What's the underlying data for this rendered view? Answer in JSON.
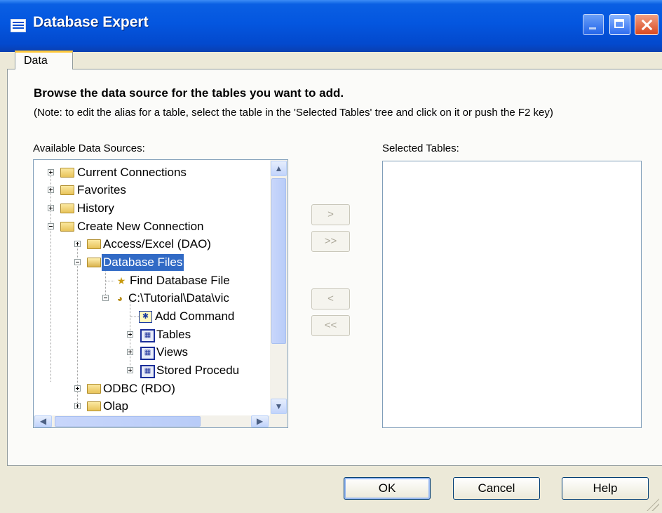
{
  "window": {
    "title": "Database Expert"
  },
  "tabs": [
    {
      "label": "Data"
    }
  ],
  "content": {
    "heading": "Browse the data source for the tables you want to add.",
    "note": "(Note: to edit the alias for a table, select the table in the 'Selected Tables' tree and click on it or push the F2 key)",
    "available_label": "Available Data Sources:",
    "selected_label": "Selected Tables:"
  },
  "tree": {
    "items": [
      {
        "label": "Current Connections",
        "expander": "plus",
        "icon": "folder-icon"
      },
      {
        "label": "Favorites",
        "expander": "plus",
        "icon": "folder-icon"
      },
      {
        "label": "History",
        "expander": "plus",
        "icon": "folder-icon"
      },
      {
        "label": "Create New Connection",
        "expander": "minus",
        "icon": "folder-icon"
      },
      {
        "label": "Access/Excel (DAO)",
        "expander": "plus",
        "icon": "folder-icon"
      },
      {
        "label": "Database Files",
        "expander": "minus",
        "icon": "open-folder-icon",
        "selected": true
      },
      {
        "label": "Find Database File",
        "icon": "find-database-icon"
      },
      {
        "label": "C:\\Tutorial\\Data\\vic",
        "expander": "minus",
        "icon": "database-icon"
      },
      {
        "label": "Add Command",
        "icon": "add-command-icon"
      },
      {
        "label": "Tables",
        "expander": "plus",
        "icon": "table-group-icon"
      },
      {
        "label": "Views",
        "expander": "plus",
        "icon": "table-group-icon"
      },
      {
        "label": "Stored Procedu",
        "expander": "plus",
        "icon": "table-group-icon"
      },
      {
        "label": "ODBC (RDO)",
        "expander": "plus",
        "icon": "folder-icon"
      },
      {
        "label": "Olap",
        "expander": "plus",
        "icon": "folder-icon"
      }
    ]
  },
  "move_buttons": {
    "add": ">",
    "add_all": ">>",
    "remove": "<",
    "remove_all": "<<"
  },
  "footer": {
    "ok": "OK",
    "cancel": "Cancel",
    "help": "Help"
  }
}
